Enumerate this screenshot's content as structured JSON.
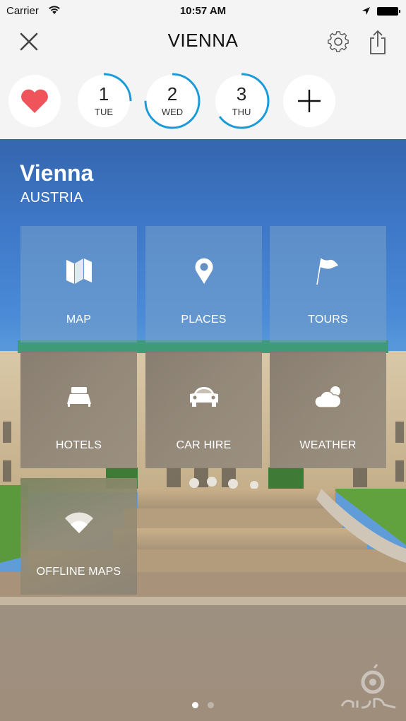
{
  "status_bar": {
    "carrier": "Carrier",
    "time": "10:57 AM",
    "wifi_icon": "wifi-icon",
    "location_icon": "location-arrow-icon",
    "battery_icon": "battery-icon"
  },
  "nav": {
    "title": "VIENNA",
    "close_icon": "close-icon",
    "settings_icon": "gear-icon",
    "share_icon": "share-icon"
  },
  "day_selector": {
    "favorites_icon": "heart-icon",
    "add_icon": "plus-icon",
    "days": [
      {
        "number": "1",
        "weekday": "TUE",
        "progress": 0.25
      },
      {
        "number": "2",
        "weekday": "WED",
        "progress": 0.75
      },
      {
        "number": "3",
        "weekday": "THU",
        "progress": 0.65
      }
    ]
  },
  "destination": {
    "city": "Vienna",
    "country": "AUSTRIA"
  },
  "tiles": [
    {
      "label": "MAP",
      "icon": "map-icon"
    },
    {
      "label": "PLACES",
      "icon": "map-pin-icon"
    },
    {
      "label": "TOURS",
      "icon": "flag-icon"
    },
    {
      "label": "HOTELS",
      "icon": "bed-icon"
    },
    {
      "label": "CAR HIRE",
      "icon": "car-icon"
    },
    {
      "label": "WEATHER",
      "icon": "cloud-sun-icon"
    },
    {
      "label": "OFFLINE MAPS",
      "icon": "signal-icon"
    }
  ],
  "pager": {
    "pages": 2,
    "current": 1
  },
  "colors": {
    "accent": "#1a9ad9",
    "heart": "#f0545b",
    "sky": "#4a8ad6"
  }
}
